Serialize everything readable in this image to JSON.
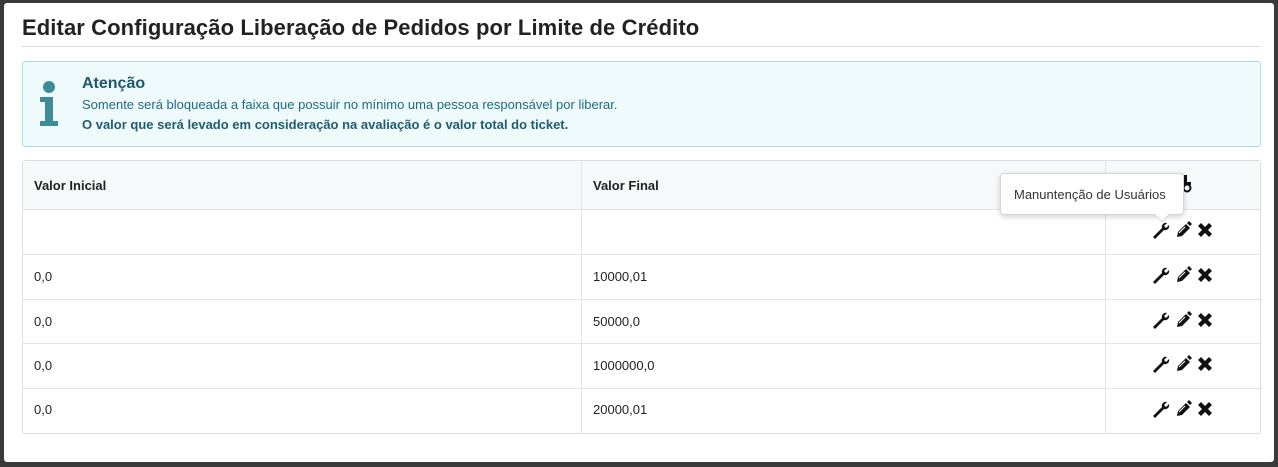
{
  "modal": {
    "title": "Editar Configuração Liberação de Pedidos por Limite de Crédito"
  },
  "alert": {
    "icon": "info-icon",
    "heading": "Atenção",
    "line1": "Somente será bloqueada a faixa que possuir no mínimo uma pessoa responsável por liberar.",
    "line2": "O valor que será levado em consideração na avaliação é o valor total do ticket."
  },
  "table": {
    "columns": [
      "Valor Inicial",
      "Valor Final"
    ],
    "header_icon": "add-icon",
    "rows": [
      {
        "valor_inicial": "",
        "valor_final": ""
      },
      {
        "valor_inicial": "0,0",
        "valor_final": "10000,01"
      },
      {
        "valor_inicial": "0,0",
        "valor_final": "50000,0"
      },
      {
        "valor_inicial": "0,0",
        "valor_final": "1000000,0"
      },
      {
        "valor_inicial": "0,0",
        "valor_final": "20000,01"
      }
    ],
    "row_actions": [
      "wrench-icon",
      "pencil-icon",
      "delete-icon"
    ]
  },
  "tooltip": {
    "text": "Manuntenção de Usuários"
  }
}
